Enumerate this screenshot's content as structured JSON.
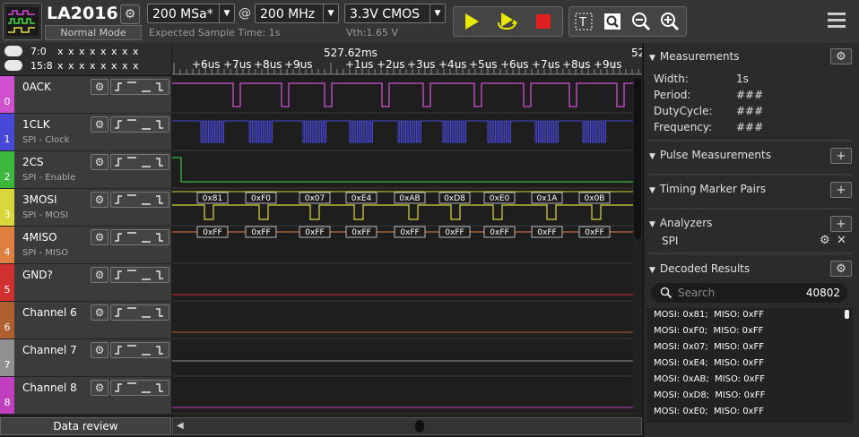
{
  "toolbar": {
    "device_name": "LA2016",
    "mode": "Normal Mode",
    "sample_rate": "200 MSa*",
    "at_sign": "@",
    "bandwidth": "200 MHz",
    "voltage": "3.3V CMOS",
    "expected_time": "Expected Sample Time: 1s",
    "vth": "Vth:1.65 V"
  },
  "timeline": {
    "status_rows": [
      {
        "bits": "7:0",
        "values": "x x x x x x x x"
      },
      {
        "bits": "15:8",
        "values": "x x x x x x x x"
      }
    ],
    "center_time": "527.62ms",
    "right_time": "52",
    "ticks": [
      "+6us",
      "+7us",
      "+8us",
      "+9us",
      "+1us",
      "+2us",
      "+3us",
      "+4us",
      "+5us",
      "+6us",
      "+7us",
      "+8us",
      "+9us"
    ]
  },
  "channels": [
    {
      "num": "0",
      "name": "0ACK",
      "sub": "",
      "color": "#d050d0"
    },
    {
      "num": "1",
      "name": "1CLK",
      "sub": "SPI - Clock",
      "color": "#4848d8"
    },
    {
      "num": "2",
      "name": "2CS",
      "sub": "SPI - Enable",
      "color": "#3cb83c"
    },
    {
      "num": "3",
      "name": "3MOSI",
      "sub": "SPI - MOSI",
      "color": "#d8d83c"
    },
    {
      "num": "4",
      "name": "4MISO",
      "sub": "SPI - MISO",
      "color": "#e08040"
    },
    {
      "num": "5",
      "name": "GND?",
      "sub": "",
      "color": "#d03030"
    },
    {
      "num": "6",
      "name": "Channel 6",
      "sub": "",
      "color": "#b06030"
    },
    {
      "num": "7",
      "name": "Channel 7",
      "sub": "",
      "color": "#909090"
    },
    {
      "num": "8",
      "name": "Channel 8",
      "sub": "",
      "color": "#c040c0"
    }
  ],
  "decode": {
    "mosi": [
      "0x81",
      "0xF0",
      "0x07",
      "0xE4",
      "0xAB",
      "0xD8",
      "0xE0",
      "0x1A",
      "0x0B"
    ],
    "miso": [
      "0xFF",
      "0xFF",
      "0xFF",
      "0xFF",
      "0xFF",
      "0xFF",
      "0xFF",
      "0xFF",
      "0xFF"
    ]
  },
  "bottom": {
    "data_review": "Data review"
  },
  "panel": {
    "measurements_title": "Measurements",
    "measurements": [
      {
        "label": "Width:",
        "value": "1s"
      },
      {
        "label": "Period:",
        "value": "###"
      },
      {
        "label": "DutyCycle:",
        "value": "###"
      },
      {
        "label": "Frequency:",
        "value": "###"
      }
    ],
    "pulse_title": "Pulse Measurements",
    "timing_title": "Timing Marker Pairs",
    "analyzers_title": "Analyzers",
    "analyzer_name": "SPI",
    "decoded_title": "Decoded Results",
    "search_placeholder": "Search",
    "result_count": "40802",
    "results": [
      "MOSI: 0x81;  MISO: 0xFF",
      "MOSI: 0xF0;  MISO: 0xFF",
      "MOSI: 0x07;  MISO: 0xFF",
      "MOSI: 0xE4;  MISO: 0xFF",
      "MOSI: 0xAB;  MISO: 0xFF",
      "MOSI: 0xD8;  MISO: 0xFF",
      "MOSI: 0xE0;  MISO: 0xFF"
    ]
  },
  "colors": {
    "run": "#e8e800",
    "stop": "#e02020",
    "accent_toolbar": "#353535"
  }
}
